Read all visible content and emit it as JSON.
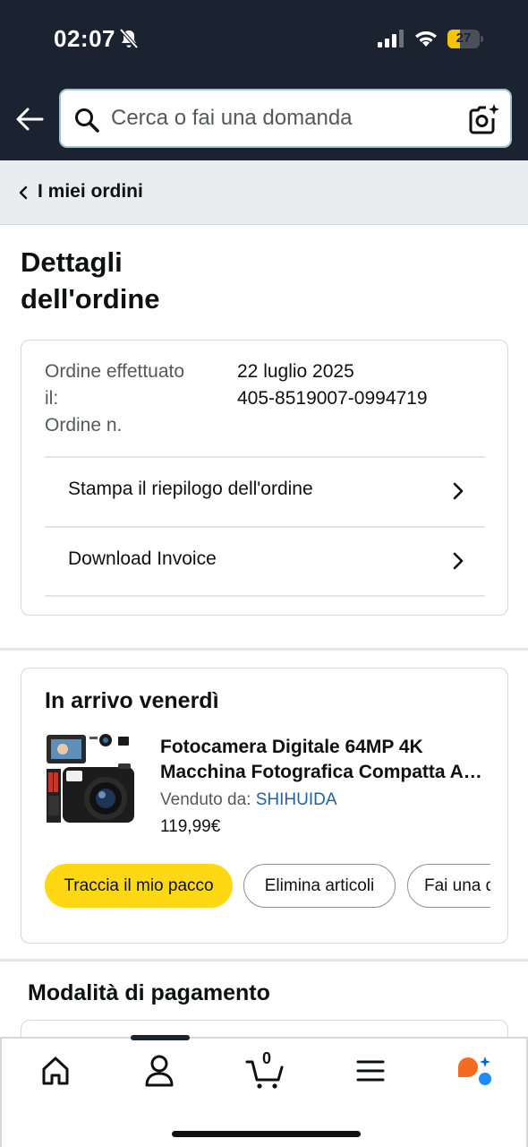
{
  "status_bar": {
    "time": "02:07",
    "battery_level": "27",
    "battery_fraction": 0.27
  },
  "search": {
    "placeholder": "Cerca o fai una domanda"
  },
  "breadcrumb": {
    "label": "I miei ordini"
  },
  "page": {
    "title_line1": "Dettagli",
    "title_line2": "dell'ordine"
  },
  "order_info": {
    "placed_label_line1": "Ordine effettuato",
    "placed_label_line2": "il:",
    "number_label": "Ordine n.",
    "placed_value": "22 luglio 2025",
    "number_value": "405-8519007-0994719",
    "print_summary": "Stampa il riepilogo dell'ordine",
    "download_invoice": "Download Invoice"
  },
  "shipment": {
    "title": "In arrivo venerdì",
    "product_title_line1": "Fotocamera Digitale 64MP 4K",
    "product_title_line2": "Macchina Fotografica Compatta Autofocus",
    "sold_by_label": "Venduto da: ",
    "seller": "SHIHUIDA",
    "price": "119,99€",
    "buttons": {
      "track": "Traccia il mio pacco",
      "remove": "Elimina articoli",
      "ask": "Fai una domanda"
    }
  },
  "payment": {
    "title": "Modalità di pagamento"
  },
  "bottom_nav": {
    "cart_count": "0"
  },
  "colors": {
    "header_bg": "#1b2230",
    "primary_button": "#ffd814",
    "link": "#2162a1",
    "battery_fill": "#f5c400"
  }
}
